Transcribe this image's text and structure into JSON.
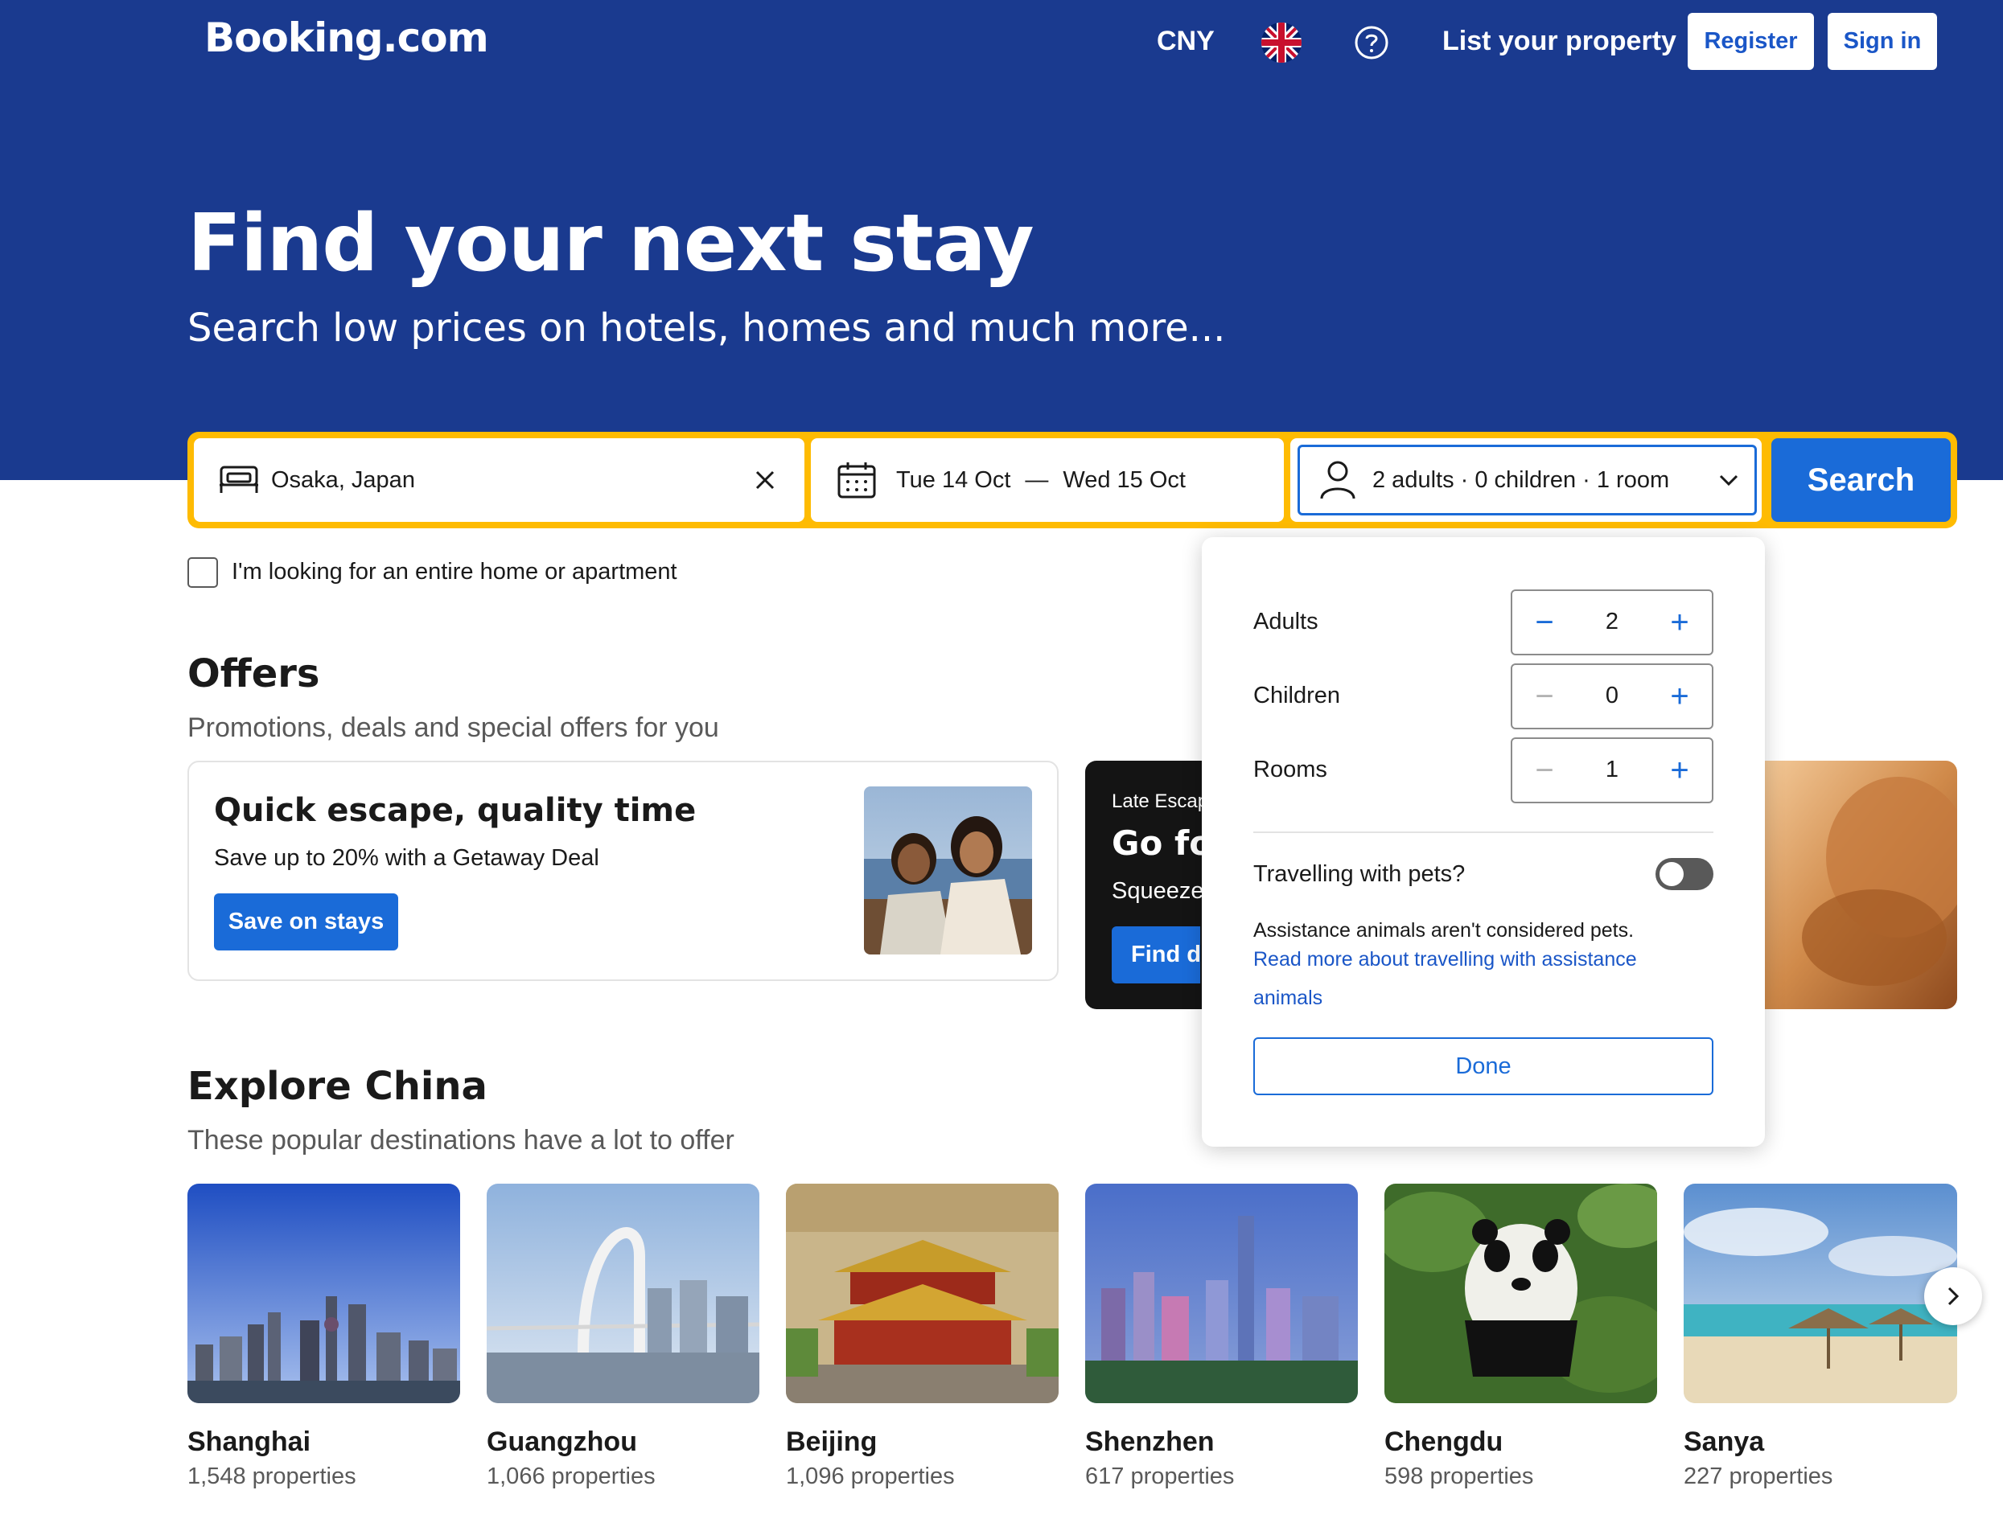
{
  "header": {
    "logo": "Booking.com",
    "currency": "CNY",
    "language_icon": "uk-flag-icon",
    "help_icon": "help-circle-icon",
    "list_property": "List your property",
    "register": "Register",
    "sign_in": "Sign in"
  },
  "hero": {
    "title": "Find your next stay",
    "subtitle": "Search low prices on hotels, homes and much more..."
  },
  "search": {
    "destination": "Osaka, Japan",
    "checkin": "Tue 14 Oct",
    "dash": "—",
    "checkout": "Wed 15 Oct",
    "occupancy": "2 adults · 0 children · 1 room",
    "button": "Search",
    "entire_home_label": "I'm looking for an entire home or apartment"
  },
  "occupancy_popup": {
    "adults_label": "Adults",
    "adults_value": "2",
    "children_label": "Children",
    "children_value": "0",
    "rooms_label": "Rooms",
    "rooms_value": "1",
    "pets_label": "Travelling with pets?",
    "pets_enabled": false,
    "assistance_note": "Assistance animals aren't considered pets.",
    "assistance_link_line1": "Read more about travelling with assistance",
    "assistance_link_line2": "animals",
    "done": "Done"
  },
  "offers": {
    "title": "Offers",
    "subtitle": "Promotions, deals and special offers for you",
    "card1": {
      "title": "Quick escape, quality time",
      "text": "Save up to 20% with a Getaway Deal",
      "button": "Save on stays"
    },
    "card2": {
      "eyebrow": "Late Escap",
      "title": "Go for",
      "text": "Squeeze",
      "button": "Find de"
    }
  },
  "explore": {
    "title": "Explore China",
    "subtitle": "These popular destinations have a lot to offer",
    "next_icon": "chevron-right-icon",
    "cities": [
      {
        "name": "Shanghai",
        "properties": "1,548 properties"
      },
      {
        "name": "Guangzhou",
        "properties": "1,066 properties"
      },
      {
        "name": "Beijing",
        "properties": "1,096 properties"
      },
      {
        "name": "Shenzhen",
        "properties": "617 properties"
      },
      {
        "name": "Chengdu",
        "properties": "598 properties"
      },
      {
        "name": "Sanya",
        "properties": "227 properties"
      }
    ]
  },
  "colors": {
    "brand_blue": "#1a3a8f",
    "action_blue": "#1a6bd8",
    "search_border": "#febb02"
  }
}
